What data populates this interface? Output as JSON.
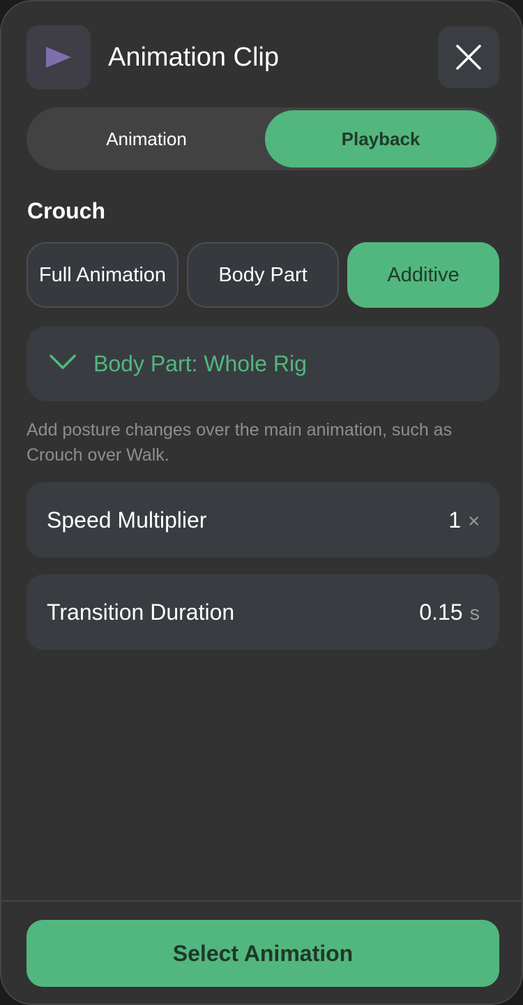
{
  "header": {
    "icon": "play-icon",
    "title": "Animation Clip",
    "close_icon": "close-icon"
  },
  "tabs": [
    {
      "label": "Animation",
      "selected": false
    },
    {
      "label": "Playback",
      "selected": true
    }
  ],
  "section": {
    "title": "Crouch"
  },
  "modes": [
    {
      "label": "Full Animation",
      "selected": false
    },
    {
      "label": "Body Part",
      "selected": false
    },
    {
      "label": "Additive",
      "selected": true
    }
  ],
  "body_part_dropdown": {
    "icon": "chevron-down-icon",
    "label": "Body Part: Whole Rig"
  },
  "description": "Add posture changes over the main animation, such as Crouch over Walk.",
  "settings": [
    {
      "label": "Speed Multiplier",
      "value": "1",
      "unit": "×"
    },
    {
      "label": "Transition Duration",
      "value": "0.15",
      "unit": "s"
    }
  ],
  "primary_button": {
    "label": "Select Animation"
  },
  "colors": {
    "accent": "#52b77e",
    "panel": "#323232",
    "card": "#393d42"
  }
}
